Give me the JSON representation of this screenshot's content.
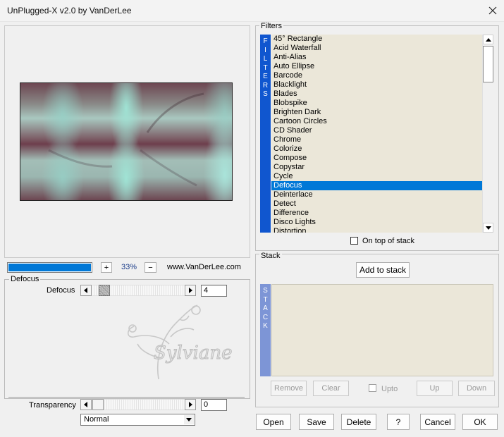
{
  "window": {
    "title": "UnPlugged-X v2.0 by VanDerLee"
  },
  "preview": {
    "zoom": "33%",
    "website": "www.VanDerLee.com",
    "progress_fraction": 1.0
  },
  "defocus_group": {
    "label": "Defocus",
    "param_label": "Defocus",
    "param_value": "4"
  },
  "transparency": {
    "label": "Transparency",
    "value": "0",
    "blend_mode": "Normal"
  },
  "watermark": {
    "text": "Sylviane"
  },
  "filters": {
    "group_label": "Filters",
    "side_label": [
      "F",
      "I",
      "L",
      "T",
      "E",
      "R",
      "S"
    ],
    "items": [
      "45° Rectangle",
      "Acid Waterfall",
      "Anti-Alias",
      "Auto Ellipse",
      "Barcode",
      "Blacklight",
      "Blades",
      "Blobspike",
      "Brighten Dark",
      "Cartoon Circles",
      "CD Shader",
      "Chrome",
      "Colorize",
      "Compose",
      "Copystar",
      "Cycle",
      "Defocus",
      "Deinterlace",
      "Detect",
      "Difference",
      "Disco Lights",
      "Distortion"
    ],
    "selected": "Defocus",
    "on_top_label": "On top of stack"
  },
  "stack": {
    "group_label": "Stack",
    "side_label": [
      "S",
      "T",
      "A",
      "C",
      "K"
    ],
    "add_label": "Add to stack",
    "remove_label": "Remove",
    "clear_label": "Clear",
    "upto_label": "Upto",
    "up_label": "Up",
    "down_label": "Down"
  },
  "buttons": {
    "open": "Open",
    "save": "Save",
    "delete": "Delete",
    "help": "?",
    "cancel": "Cancel",
    "ok": "OK"
  },
  "icons": {
    "close": "close-icon",
    "plus": "+",
    "minus": "−"
  },
  "colors": {
    "selection": "#0078d7",
    "filters_bar": "#1056cf",
    "stack_bar": "#7d95d6",
    "list_bg": "#ebe7d9"
  }
}
